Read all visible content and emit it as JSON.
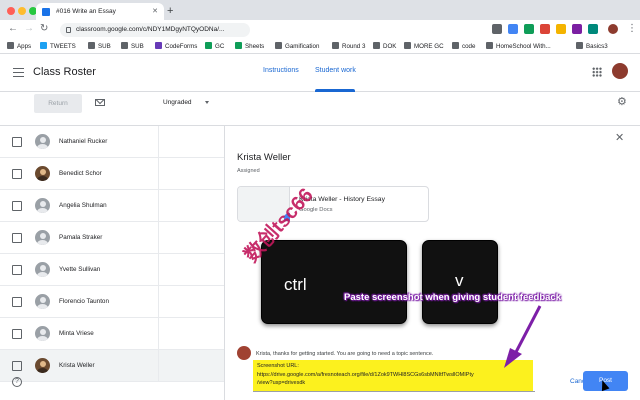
{
  "browser": {
    "tab_title": "#016 Write an Essay",
    "url": "classroom.google.com/c/NDY1MDgyNTQyODNa/...",
    "bookmarks": [
      "Apps",
      "TWEETS",
      "SUB",
      "SUB",
      "CodeForms",
      "GC",
      "Sheets",
      "Gamification",
      "Round 3",
      "DOK",
      "MORE GC",
      "code",
      "HomeSchool With...",
      "Basics3"
    ]
  },
  "app": {
    "title": "Class Roster",
    "tabs": [
      {
        "label": "Instructions",
        "active": false
      },
      {
        "label": "Student work",
        "active": true
      }
    ],
    "return_label": "Return",
    "grading_label": "Ungraded"
  },
  "students": [
    {
      "name": "Nathaniel Rucker"
    },
    {
      "name": "Benedict Schor"
    },
    {
      "name": "Angelia Shulman"
    },
    {
      "name": "Pamala Straker"
    },
    {
      "name": "Yvette Sullivan"
    },
    {
      "name": "Florencio Taunton"
    },
    {
      "name": "Minta Vriese"
    },
    {
      "name": "Krista Weller",
      "selected": true
    }
  ],
  "detail": {
    "student_name": "Krista Weller",
    "status": "Assigned",
    "attachment_title": "Krista Weller - History Essay",
    "attachment_type": "Google Docs",
    "keys": [
      "ctrl",
      "v"
    ],
    "comment_text": "Krista, thanks for getting started. You are going to need a topic sentence.",
    "url_label": "Screenshot URL:",
    "url_line1": "https://drive.google.com/a/fresnoteach.org/file/d/1Zok9TWHl8SCGs6sbMNItfTwsllOMIPty",
    "url_line2": "/view?usp=drivesdk",
    "cancel_label": "Cancel",
    "post_label": "Post"
  },
  "annotation": {
    "callout": "Paste screenshot when giving student feedback",
    "watermark": "数创tsc66"
  },
  "colors": {
    "accent": "#1967d2",
    "post_button": "#4285f4",
    "highlight": "#fcf11e",
    "annotation_purple": "#7d1fa8"
  }
}
